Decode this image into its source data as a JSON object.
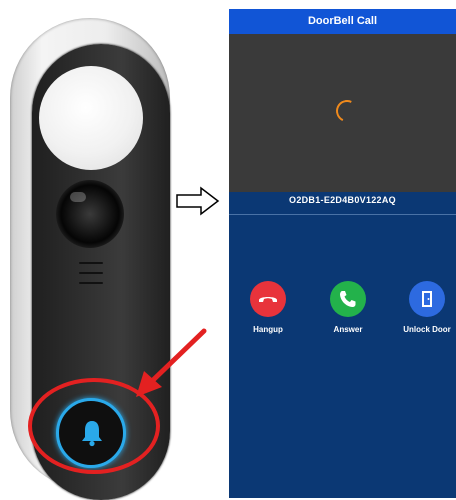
{
  "phone": {
    "title": "DoorBell Call",
    "device_id": "O2DB1-E2D4B0V122AQ",
    "actions": [
      {
        "label": "Hangup",
        "icon": "phone-hangup-icon",
        "color": "#e8333b"
      },
      {
        "label": "Answer",
        "icon": "phone-answer-icon",
        "color": "#23b24b"
      },
      {
        "label": "Unlock Door",
        "icon": "door-icon",
        "color": "#2d6ae0"
      }
    ]
  },
  "colors": {
    "title_bar": "#1155d6",
    "screen_bg": "#0b3874",
    "video_bg": "#3a3a3a",
    "spinner": "#f08a1c",
    "highlight": "#e32121",
    "bell_ring": "#2aa9ea"
  },
  "icons": {
    "bell": "bell-icon",
    "spinner": "loading-spinner-icon",
    "transition": "right-arrow-icon"
  }
}
